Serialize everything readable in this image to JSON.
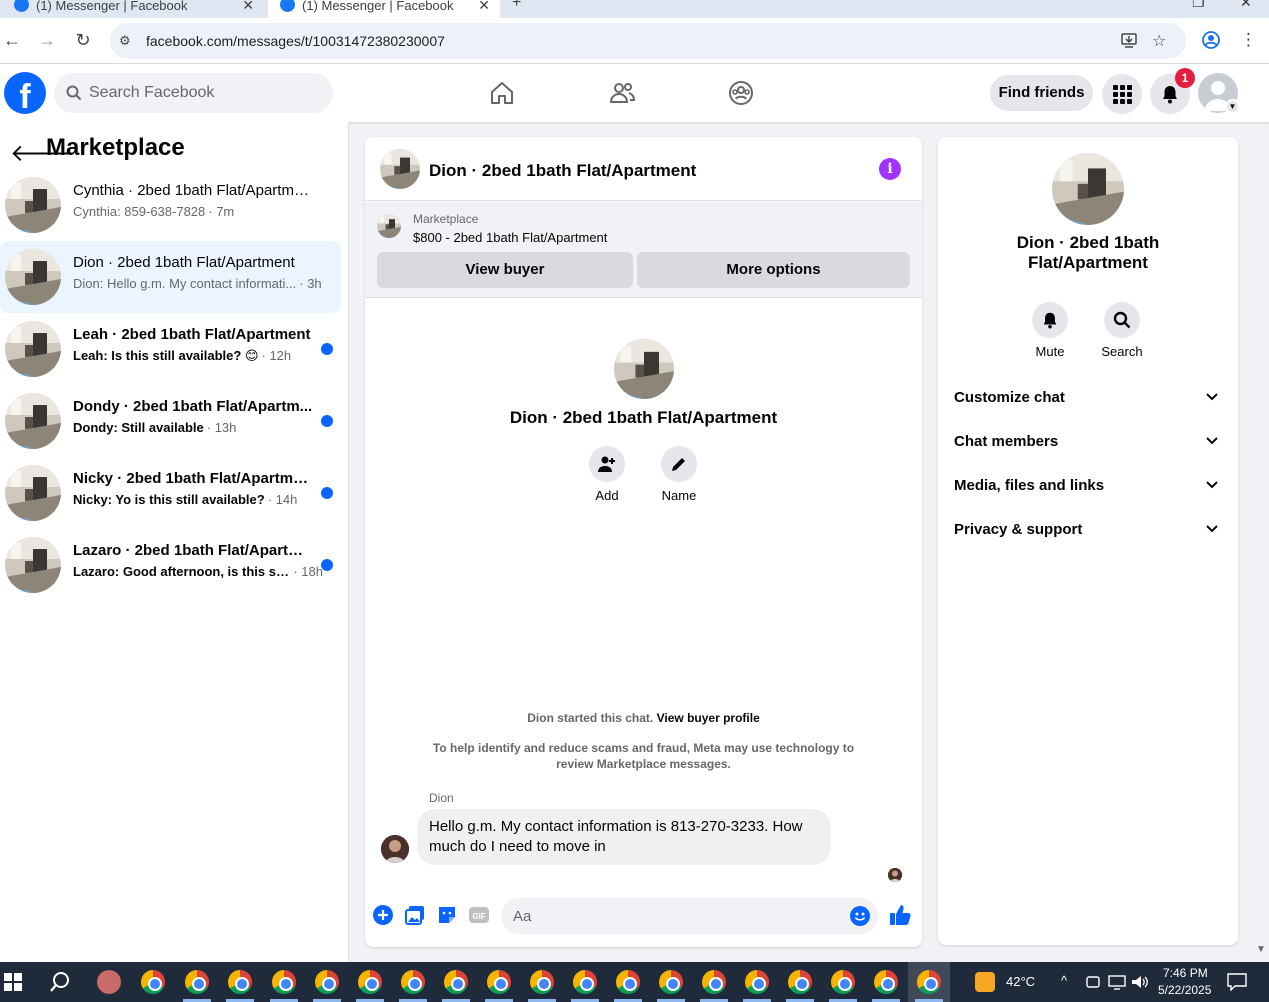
{
  "browser": {
    "tabs": [
      {
        "title": "(1) Messenger | Facebook",
        "active": false
      },
      {
        "title": "(1) Messenger | Facebook",
        "active": true
      }
    ],
    "url": "facebook.com/messages/t/10031472380230007"
  },
  "header": {
    "search_placeholder": "Search Facebook",
    "find_friends_label": "Find friends",
    "notification_count": "1"
  },
  "sidebar": {
    "title": "Marketplace",
    "conversations": [
      {
        "name": "Cynthia · 2bed 1bath Flat/Apartment",
        "preview": "Cynthia: 859-638-7828",
        "time": "· 7m",
        "unread": false,
        "active": false
      },
      {
        "name": "Dion · 2bed 1bath Flat/Apartment",
        "preview": "Dion: Hello g.m. My contact informati...",
        "time": "· 3h",
        "unread": false,
        "active": true
      },
      {
        "name": "Leah · 2bed 1bath Flat/Apartment",
        "preview": "Leah: Is this still available? 😊",
        "time": "· 12h",
        "unread": true,
        "active": false
      },
      {
        "name": "Dondy · 2bed 1bath Flat/Apartm...",
        "preview": "Dondy: Still available",
        "time": "· 13h",
        "unread": true,
        "active": false
      },
      {
        "name": "Nicky · 2bed 1bath Flat/Apartment",
        "preview": "Nicky: Yo is this still available?",
        "time": "· 14h",
        "unread": true,
        "active": false
      },
      {
        "name": "Lazaro · 2bed 1bath Flat/Apartm...",
        "preview": "Lazaro: Good afternoon, is this sti...",
        "time": "· 18h",
        "unread": true,
        "active": false
      }
    ]
  },
  "chat": {
    "title": "Dion · 2bed 1bath Flat/Apartment",
    "marketplace_label": "Marketplace",
    "listing": "$800 - 2bed 1bath Flat/Apartment",
    "view_buyer_label": "View buyer",
    "more_options_label": "More options",
    "center_name": "Dion · 2bed 1bath Flat/Apartment",
    "add_label": "Add",
    "name_label": "Name",
    "started_text": "Dion started this chat.",
    "view_buyer_profile": "View buyer profile",
    "disclaimer": "To help identify and reduce scams and fraud, Meta may use technology to review Marketplace messages.",
    "sender": "Dion",
    "message": "Hello g.m. My contact information is 813-270-3233. How much do I need to move in",
    "composer_placeholder": "Aa"
  },
  "details": {
    "name": "Dion · 2bed 1bath Flat/Apartment",
    "mute_label": "Mute",
    "search_label": "Search",
    "sections": [
      "Customize chat",
      "Chat members",
      "Media, files and links",
      "Privacy & support"
    ]
  },
  "taskbar": {
    "temperature": "42°C",
    "time": "7:46 PM",
    "date": "5/22/2025"
  },
  "colors": {
    "brand": "#0866ff",
    "active_row": "#ebf5ff",
    "info_icon": "#a033ff",
    "badge": "#e41e3f"
  }
}
